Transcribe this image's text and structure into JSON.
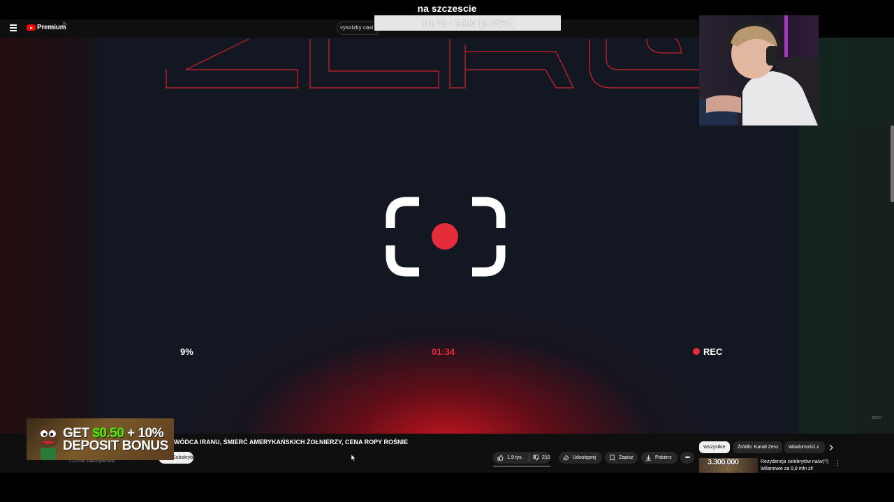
{
  "stream": {
    "title": "na szczescie",
    "counter": "10.75 / 1020 (1.05%)"
  },
  "youtube": {
    "brand": "Premium",
    "region_sup": "PL",
    "search_text": "vysotzky casi"
  },
  "video": {
    "percent": "9%",
    "time": "01:34",
    "rec_label": "REC",
    "watermark": "ZERO"
  },
  "below_video": {
    "title": "WÓDCA IRANU, ŚMIERĆ AMERYKAŃSKICH ŻOŁNIERZY, CENA ROPY ROŚNIE",
    "subs": "2,19 mln subskrybentów",
    "subscribe_label": "Subskrybuj",
    "likes": "1,9 tys.",
    "dislikes": "210",
    "share": "Udostępnij",
    "save": "Zapisz",
    "download": "Pobierz",
    "more": "•••"
  },
  "ad": {
    "line1_a": "GET ",
    "line1_b": "$0.50",
    "line1_c": " + 10%",
    "line2": "DEPOSIT BONUS"
  },
  "sidebar": {
    "chips": [
      "Wszystkie",
      "Źródło: Kanał Zero",
      "Wiadomości z"
    ],
    "rec_thumb_text": "3.300.000",
    "rec_title_1": "Rezydencja celebrytów na/w(?)",
    "rec_title_2": "Wilanowie za 9,8 mln zł!"
  },
  "colors": {
    "accent_red": "#e52c3a",
    "yt_red": "#ff0000",
    "ad_green": "#4ef000"
  }
}
